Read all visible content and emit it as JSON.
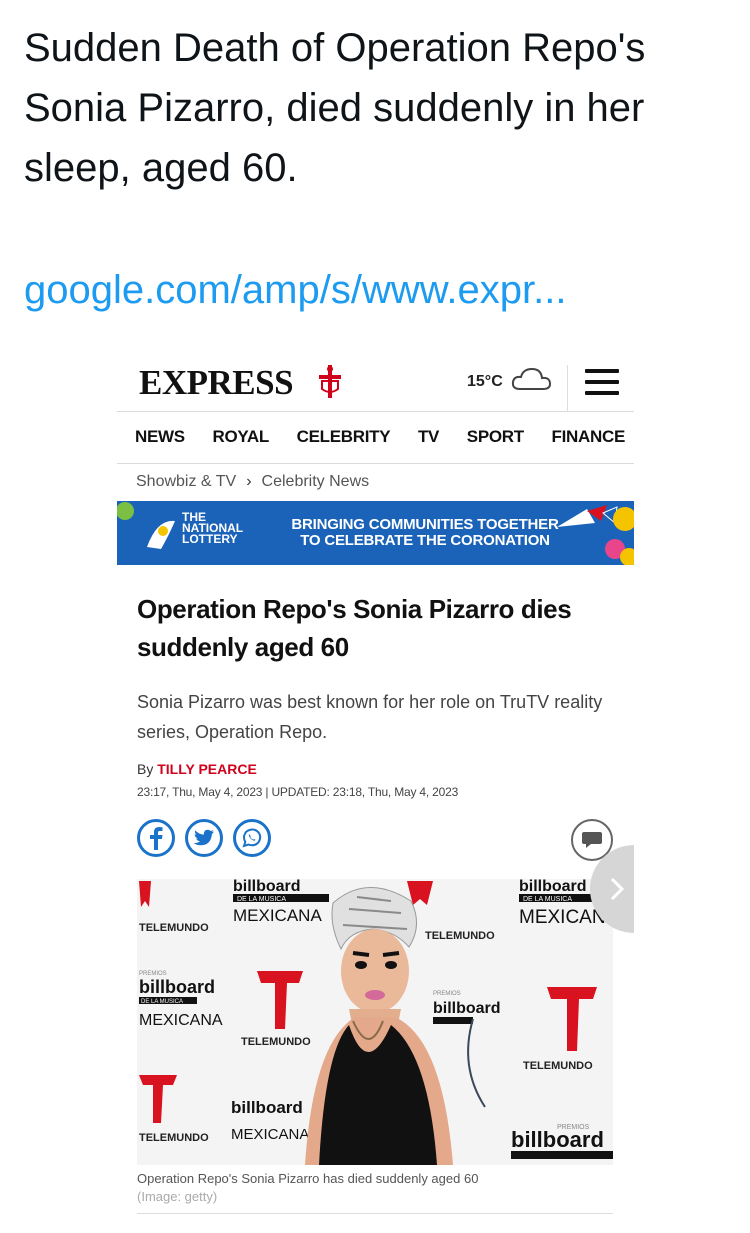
{
  "tweet": {
    "text": "Sudden Death of Operation Repo's Sonia Pizarro, died suddenly in her sleep, aged 60.",
    "link": "google.com/amp/s/www.expr..."
  },
  "site": {
    "logo": "EXPRESS",
    "weather": "15°C",
    "nav": [
      "NEWS",
      "ROYAL",
      "CELEBRITY",
      "TV",
      "SPORT",
      "FINANCE"
    ],
    "breadcrumb": [
      "Showbiz & TV",
      "Celebrity News"
    ]
  },
  "banner": {
    "brand": [
      "THE",
      "NATIONAL",
      "LOTTERY"
    ],
    "message_line1": "BRINGING COMMUNITIES TOGETHER",
    "message_line2": "TO CELEBRATE THE CORONATION"
  },
  "article": {
    "headline": "Operation Repo's Sonia Pizarro dies suddenly aged 60",
    "standfirst": "Sonia Pizarro was best known for her role on TruTV reality series, Operation Repo.",
    "byline_prefix": "By",
    "author": "TILLY PEARCE",
    "dates": "23:17, Thu, May 4, 2023 | UPDATED: 23:18, Thu, May 4, 2023",
    "caption": "Operation Repo's Sonia Pizarro has died suddenly aged 60",
    "credit": "(Image: getty)"
  },
  "backdrop": {
    "billboard": "billboard",
    "de_la_musica": "DE LA MUSICA",
    "mexicana": "MEXICANA",
    "premios": "PREMIOS",
    "telemundo": "TELEMUNDO"
  },
  "colors": {
    "link": "#1d9bf0",
    "nav_text": "#111111",
    "author": "#d0021b",
    "banner": "#1a63b8",
    "social": "#1a73c9",
    "telemundo_red": "#d8121f"
  },
  "icons": {
    "crusader": "crusader-logo-icon",
    "weather": "cloud-icon",
    "menu": "hamburger-menu-icon",
    "breadcrumb_separator": "chevron-right-icon",
    "share": [
      "facebook-icon",
      "twitter-icon",
      "whatsapp-icon"
    ],
    "comments": "comment-icon",
    "gallery": "chevron-right-icon"
  }
}
